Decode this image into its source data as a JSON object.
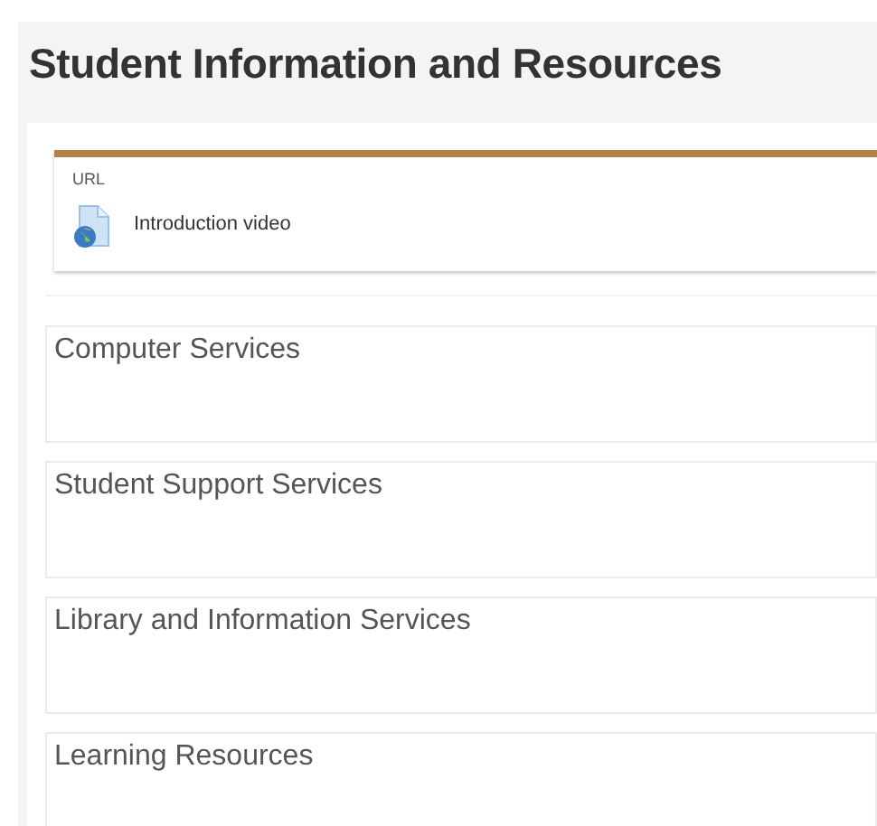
{
  "title": "Student Information and Resources",
  "activity": {
    "type_label": "URL",
    "name": "Introduction video"
  },
  "sections": [
    {
      "title": "Computer Services"
    },
    {
      "title": "Student Support Services"
    },
    {
      "title": "Library and Information Services"
    },
    {
      "title": "Learning Resources"
    }
  ]
}
